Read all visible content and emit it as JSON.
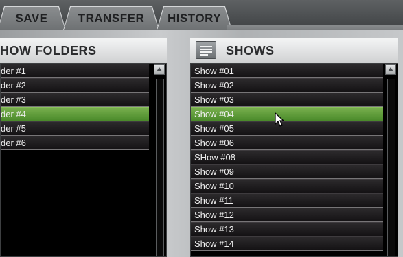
{
  "tabs": [
    {
      "label": "SAVE"
    },
    {
      "label": "TRANSFER"
    },
    {
      "label": "HISTORY"
    }
  ],
  "folders": {
    "title": "HOW FOLDERS",
    "items": [
      "der #1",
      "der #2",
      "der #3",
      "der #4",
      "der #5",
      "der #6"
    ],
    "selected_index": 3
  },
  "shows": {
    "title": "SHOWS",
    "menu_icon": "list-menu-icon",
    "items": [
      "Show #01",
      "Show #02",
      "Show #03",
      "Show #04",
      "Show #05",
      "Show #06",
      "SHow #08",
      "Show #09",
      "Show #10",
      "Show #11",
      "Show #12",
      "Show #13",
      "Show #14"
    ],
    "selected_index": 3
  },
  "colors": {
    "selected_row": "#5e9c39",
    "row": "#1e1c1e",
    "list_background": "#000000"
  }
}
